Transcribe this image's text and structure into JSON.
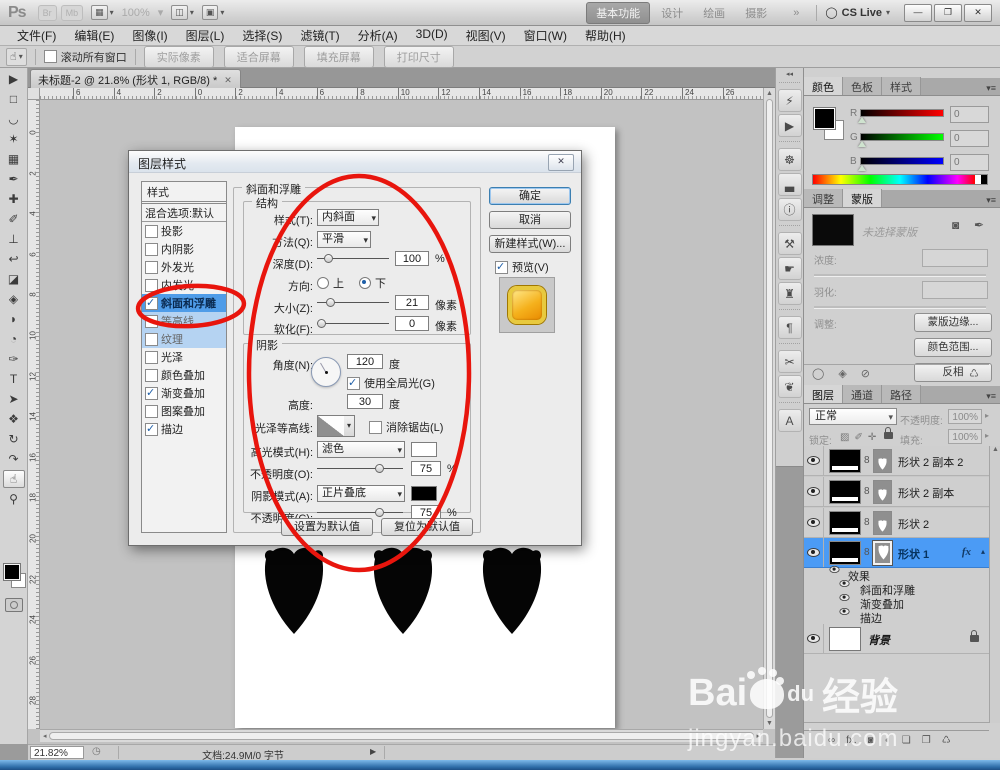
{
  "app": {
    "logo": "Ps",
    "disabled_buttons": [
      "Br",
      "Mb"
    ],
    "zoom_indicator": "100%",
    "workspaces": [
      "基本功能",
      "设计",
      "绘画",
      "摄影"
    ],
    "workspace_more": "»",
    "cslive_label": "CS Live",
    "window_buttons": [
      "—",
      "❐",
      "✕"
    ],
    "menus": [
      "文件(F)",
      "编辑(E)",
      "图像(I)",
      "图层(L)",
      "选择(S)",
      "滤镜(T)",
      "分析(A)",
      "3D(D)",
      "视图(V)",
      "窗口(W)",
      "帮助(H)"
    ],
    "options_bar": {
      "scroll_all_label": "滚动所有窗口",
      "buttons": [
        "实际像素",
        "适合屏幕",
        "填充屏幕",
        "打印尺寸"
      ]
    }
  },
  "icons": {
    "hand_tool": "☝",
    "dropdown": "▾",
    "panel_menu": "▾≡",
    "doc_tab_close": "✕",
    "dialog_close": "✕",
    "cs_live_circle": "◯",
    "collapse_arrows": "◂◂",
    "scroll_up": "▲",
    "scroll_down": "▼",
    "scroll_left": "◂",
    "scroll_right": "▸",
    "status_clock": "◷",
    "status_arrow": "▶",
    "link_8": "8",
    "fx": "fx",
    "row_arrow": "▴"
  },
  "tools": [
    {
      "name": "move-tool",
      "glyph": "▶"
    },
    {
      "name": "marquee-tool",
      "glyph": "□"
    },
    {
      "name": "lasso-tool",
      "glyph": "◡"
    },
    {
      "name": "magic-wand-tool",
      "glyph": "✶"
    },
    {
      "name": "crop-tool",
      "glyph": "▦"
    },
    {
      "name": "eyedropper-tool",
      "glyph": "✒"
    },
    {
      "name": "healing-brush-tool",
      "glyph": "✚"
    },
    {
      "name": "brush-tool",
      "glyph": "✐"
    },
    {
      "name": "clone-stamp-tool",
      "glyph": "⊥"
    },
    {
      "name": "history-brush-tool",
      "glyph": "↩"
    },
    {
      "name": "eraser-tool",
      "glyph": "◪"
    },
    {
      "name": "gradient-bucket-tool",
      "glyph": "◈"
    },
    {
      "name": "blur-tool",
      "glyph": "◗"
    },
    {
      "name": "dodge-tool",
      "glyph": "◔"
    },
    {
      "name": "pen-tool",
      "glyph": "✑"
    },
    {
      "name": "type-tool",
      "glyph": "T"
    },
    {
      "name": "path-selection-tool",
      "glyph": "➤"
    },
    {
      "name": "custom-shape-tool",
      "glyph": "❖"
    },
    {
      "name": "3d-rotate-tool",
      "glyph": "↻"
    },
    {
      "name": "3d-orbit-tool",
      "glyph": "↷"
    },
    {
      "name": "hand-tool",
      "glyph": "☝",
      "selected": true
    },
    {
      "name": "zoom-tool",
      "glyph": "⚲"
    }
  ],
  "panel_strip_icons": [
    {
      "name": "panel-icon-mini-bridge",
      "glyph": "⚡"
    },
    {
      "name": "panel-icon-actions",
      "glyph": "▶"
    },
    {
      "name": "panel-icon-navigator",
      "glyph": "☸"
    },
    {
      "name": "panel-icon-histogram",
      "glyph": "▃"
    },
    {
      "name": "panel-icon-info",
      "glyph": "ⓘ"
    },
    {
      "name": "panel-icon-brushes",
      "glyph": "⚒"
    },
    {
      "name": "panel-icon-tool-presets",
      "glyph": "☛"
    },
    {
      "name": "panel-icon-clone-source",
      "glyph": "♜"
    },
    {
      "name": "panel-icon-paragraph",
      "glyph": "¶"
    },
    {
      "name": "panel-icon-measurement",
      "glyph": "✂"
    },
    {
      "name": "panel-icon-notes",
      "glyph": "❦"
    },
    {
      "name": "panel-icon-character",
      "glyph": "A"
    }
  ],
  "document": {
    "tab_title": "未标题-2 @ 21.8% (形状 1, RGB/8) *",
    "ruler_h": [
      "6",
      "4",
      "2",
      "0",
      "2",
      "4",
      "6",
      "8",
      "10",
      "12",
      "14",
      "16",
      "18",
      "20",
      "22",
      "24",
      "26"
    ],
    "ruler_v": [
      "0",
      "2",
      "4",
      "6",
      "8",
      "10",
      "12",
      "14",
      "16",
      "18",
      "20",
      "22",
      "24",
      "26",
      "28"
    ]
  },
  "dialog": {
    "title": "图层样式",
    "styles_header": "样式",
    "styles": [
      {
        "label": "混合选项:默认",
        "has_checkbox": false,
        "state": ""
      },
      {
        "label": "投影",
        "has_checkbox": true,
        "checked": false,
        "state": ""
      },
      {
        "label": "内阴影",
        "has_checkbox": true,
        "checked": false,
        "state": ""
      },
      {
        "label": "外发光",
        "has_checkbox": true,
        "checked": false,
        "state": ""
      },
      {
        "label": "内发光",
        "has_checkbox": true,
        "checked": false,
        "state": ""
      },
      {
        "label": "斜面和浮雕",
        "has_checkbox": true,
        "checked": true,
        "state": "selected"
      },
      {
        "label": "等高线",
        "has_checkbox": true,
        "checked": false,
        "state": "sub"
      },
      {
        "label": "纹理",
        "has_checkbox": true,
        "checked": false,
        "state": "sub"
      },
      {
        "label": "光泽",
        "has_checkbox": true,
        "checked": false,
        "state": ""
      },
      {
        "label": "颜色叠加",
        "has_checkbox": true,
        "checked": false,
        "state": ""
      },
      {
        "label": "渐变叠加",
        "has_checkbox": true,
        "checked": true,
        "state": ""
      },
      {
        "label": "图案叠加",
        "has_checkbox": true,
        "checked": false,
        "state": ""
      },
      {
        "label": "描边",
        "has_checkbox": true,
        "checked": true,
        "state": ""
      }
    ],
    "section_title": "斜面和浮雕",
    "structure": {
      "legend": "结构",
      "style_label": "样式(T):",
      "style_value": "内斜面",
      "technique_label": "方法(Q):",
      "technique_value": "平滑",
      "depth_label": "深度(D):",
      "depth_value": "100",
      "depth_unit": "%",
      "direction_label": "方向:",
      "direction_up": "上",
      "direction_down": "下",
      "size_label": "大小(Z):",
      "size_value": "21",
      "size_unit": "像素",
      "soften_label": "软化(F):",
      "soften_value": "0",
      "soften_unit": "像素"
    },
    "shading": {
      "legend": "阴影",
      "angle_label": "角度(N):",
      "angle_value": "120",
      "angle_unit": "度",
      "global_light_label": "使用全局光(G)",
      "altitude_label": "高度:",
      "altitude_value": "30",
      "altitude_unit": "度",
      "contour_label": "光泽等高线:",
      "antialias_label": "消除锯齿(L)",
      "highlight_label": "高光模式(H):",
      "highlight_value": "滤色",
      "h_opacity_label": "不透明度(O):",
      "h_opacity_value": "75",
      "h_opacity_unit": "%",
      "shadow_label": "阴影模式(A):",
      "shadow_value": "正片叠底",
      "s_opacity_label": "不透明度(C):",
      "s_opacity_value": "75",
      "s_opacity_unit": "%"
    },
    "footer_buttons": [
      "设置为默认值",
      "复位为默认值"
    ],
    "ok_label": "确定",
    "cancel_label": "取消",
    "new_style_label": "新建样式(W)...",
    "preview_label": "预览(V)"
  },
  "panels": {
    "color": {
      "tabs": [
        "颜色",
        "色板",
        "样式"
      ],
      "channels": [
        {
          "label": "R",
          "value": "0",
          "key": "r"
        },
        {
          "label": "G",
          "value": "0",
          "key": "g"
        },
        {
          "label": "B",
          "value": "0",
          "key": "b"
        }
      ]
    },
    "masks": {
      "tabs": [
        "调整",
        "蒙版"
      ],
      "no_mask_label": "未选择蒙版",
      "top_icons": [
        "◙",
        "✒"
      ],
      "density_label": "浓度:",
      "feather_label": "羽化:",
      "adjust_label": "调整:",
      "buttons": [
        "蒙版边缘...",
        "颜色范围...",
        "反相"
      ],
      "bottom_icons": [
        "◯",
        "◈",
        "⊘",
        "♺"
      ]
    },
    "layers": {
      "tabs": [
        "图层",
        "通道",
        "路径"
      ],
      "blend_mode": "正常",
      "opacity_label": "不透明度:",
      "opacity_value": "100%",
      "lock_label": "锁定:",
      "lock_icons": [
        "▨",
        "✐",
        "✛"
      ],
      "fill_label": "填充:",
      "fill_value": "100%",
      "rows": [
        {
          "name": "形状 2 副本 2",
          "selected": false
        },
        {
          "name": "形状 2 副本",
          "selected": false
        },
        {
          "name": "形状 2",
          "selected": false
        },
        {
          "name": "形状 1",
          "selected": true
        }
      ],
      "effects": [
        "效果",
        "斜面和浮雕",
        "渐变叠加",
        "描边"
      ],
      "background_name": "背景",
      "bottom_icons": [
        "∞",
        "fx.",
        "◙",
        "◐",
        "❏",
        "❐",
        "♺"
      ]
    }
  },
  "statusbar": {
    "zoom": "21.82%",
    "doc_info": "文档:24.9M/0 字节"
  },
  "watermark": {
    "brand": "Bai",
    "brand2": "du",
    "suffix": "经验",
    "url": "jingyan.baidu.com"
  },
  "colors": {
    "selection_blue": "#4b9bf5",
    "annotation_red": "#e8150d",
    "preview_orange": "#f0a21d"
  }
}
